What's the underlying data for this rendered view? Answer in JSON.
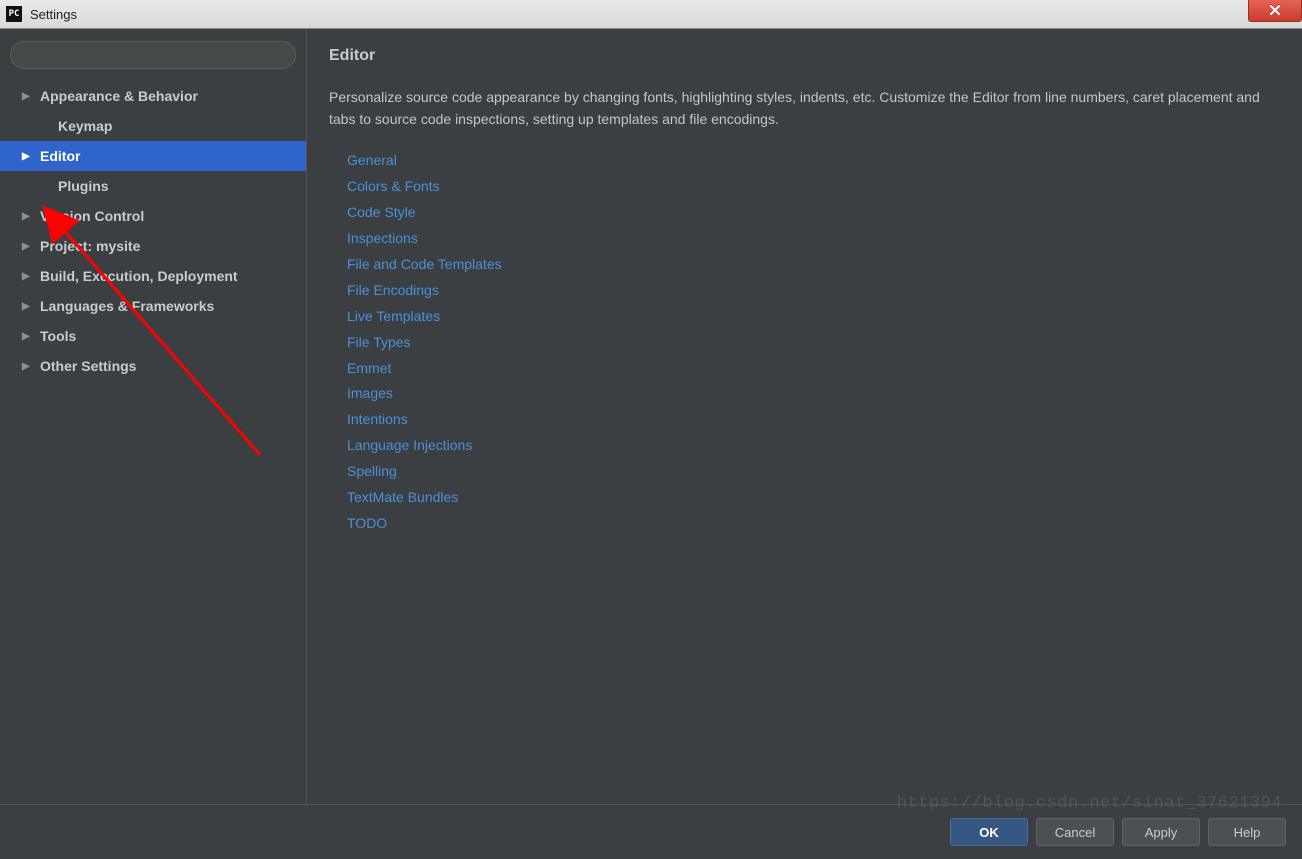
{
  "titlebar": {
    "app_icon_text": "PC",
    "title": "Settings"
  },
  "sidebar": {
    "search_placeholder": "",
    "items": [
      {
        "label": "Appearance & Behavior",
        "expandable": true
      },
      {
        "label": "Keymap",
        "expandable": false,
        "child": true
      },
      {
        "label": "Editor",
        "expandable": true,
        "selected": true
      },
      {
        "label": "Plugins",
        "expandable": false,
        "child": true
      },
      {
        "label": "Version Control",
        "expandable": true
      },
      {
        "label": "Project: mysite",
        "expandable": true
      },
      {
        "label": "Build, Execution, Deployment",
        "expandable": true
      },
      {
        "label": "Languages & Frameworks",
        "expandable": true
      },
      {
        "label": "Tools",
        "expandable": true
      },
      {
        "label": "Other Settings",
        "expandable": true
      }
    ]
  },
  "content": {
    "heading": "Editor",
    "description": "Personalize source code appearance by changing fonts, highlighting styles, indents, etc. Customize the Editor from line numbers, caret placement and tabs to source code inspections, setting up templates and file encodings.",
    "links": [
      "General",
      "Colors & Fonts",
      "Code Style",
      "Inspections",
      "File and Code Templates",
      "File Encodings",
      "Live Templates",
      "File Types",
      "Emmet",
      "Images",
      "Intentions",
      "Language Injections",
      "Spelling",
      "TextMate Bundles",
      "TODO"
    ]
  },
  "buttons": {
    "ok": "OK",
    "cancel": "Cancel",
    "apply": "Apply",
    "help": "Help"
  },
  "watermark": "https://blog.csdn.net/sinat_37621394"
}
